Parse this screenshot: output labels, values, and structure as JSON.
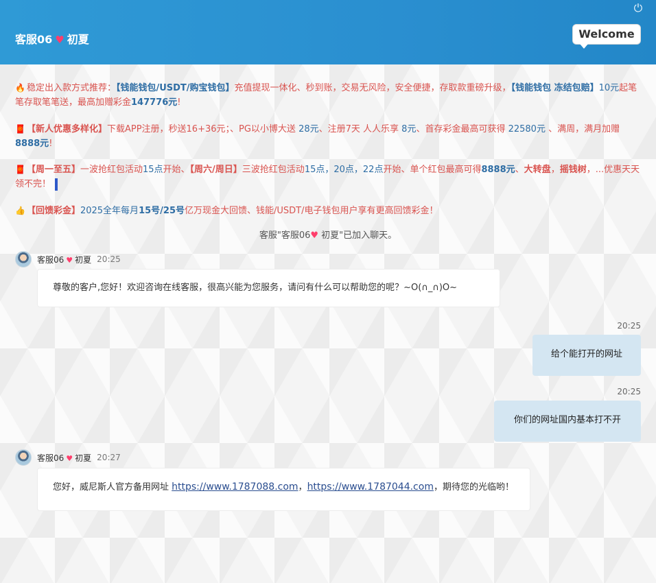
{
  "header": {
    "title_prefix": "客服06",
    "title_heart": "♥",
    "title_suffix": "初夏",
    "welcome": "Welcome",
    "power_icon": "⏻"
  },
  "notices": [
    {
      "icon": "🔥",
      "parts": [
        {
          "t": "稳定出入款方式推荐：",
          "c": "red"
        },
        {
          "t": "【钱能钱包/USDT/购宝钱包】",
          "c": "blue",
          "b": true
        },
        {
          "t": "充值提现一体化、秒到账，交易无风险，安全便捷，存取款重磅升级，",
          "c": "red"
        },
        {
          "t": "【钱能钱包 冻结包赔】",
          "c": "blue",
          "b": true
        },
        {
          "t": "10元",
          "c": "blue"
        },
        {
          "t": "起笔笔存取笔笔送，最高加赠彩金",
          "c": "red"
        },
        {
          "t": "147776元",
          "c": "blue",
          "b": true
        },
        {
          "t": "!",
          "c": "red"
        }
      ]
    },
    {
      "icon": "🧧",
      "parts": [
        {
          "t": "【新人优惠多样化】",
          "c": "red",
          "b": true
        },
        {
          "t": "下载APP注册，秒送16+36元；、PG以小博大送 ",
          "c": "red"
        },
        {
          "t": "28元",
          "c": "blue"
        },
        {
          "t": "、注册7天 人人乐享 ",
          "c": "red"
        },
        {
          "t": "8元",
          "c": "blue"
        },
        {
          "t": "、首存彩金最高可获得 ",
          "c": "red"
        },
        {
          "t": "22580元",
          "c": "blue"
        },
        {
          "t": " 、满周，满月加赠 ",
          "c": "red"
        },
        {
          "t": "8888元",
          "c": "blue",
          "b": true
        },
        {
          "t": "!",
          "c": "red"
        }
      ]
    },
    {
      "icon": "🧧",
      "parts": [
        {
          "t": "【周一至五】",
          "c": "red",
          "b": true
        },
        {
          "t": "一波抢红包活动",
          "c": "red"
        },
        {
          "t": "15点",
          "c": "blue"
        },
        {
          "t": "开始、",
          "c": "red"
        },
        {
          "t": "【周六/周日】",
          "c": "red",
          "b": true
        },
        {
          "t": "三波抢红包活动",
          "c": "red"
        },
        {
          "t": "15点，20点，22点",
          "c": "blue"
        },
        {
          "t": "开始、单个红包最高可得",
          "c": "red"
        },
        {
          "t": "8888元",
          "c": "blue",
          "b": true
        },
        {
          "t": "、",
          "c": "red"
        },
        {
          "t": "大转盘",
          "c": "red",
          "b": true
        },
        {
          "t": "，",
          "c": "red"
        },
        {
          "t": "摇钱树",
          "c": "red",
          "b": true
        },
        {
          "t": "，...优惠天天领不完！",
          "c": "red"
        }
      ]
    },
    {
      "icon": "👍",
      "parts": [
        {
          "t": "【回馈彩金】",
          "c": "red",
          "b": true
        },
        {
          "t": "2025全年每月",
          "c": "blue"
        },
        {
          "t": "15号/25号",
          "c": "blue",
          "b": true
        },
        {
          "t": "亿万现金大回馈、钱能/USDT/电子钱包用户享有更高回馈彩金！",
          "c": "red"
        }
      ]
    }
  ],
  "joined": {
    "prefix": "客服\"客服06",
    "heart": "♥",
    "suffix": " 初夏\"已加入聊天。"
  },
  "messages": [
    {
      "side": "left",
      "name_prefix": "客服06",
      "name_heart": "♥",
      "name_suffix": "初夏",
      "time": "20:25",
      "text": "尊敬的客户,您好！欢迎咨询在线客服，很高兴能为您服务，请问有什么可以帮助您的呢？~O(∩_∩)O~"
    },
    {
      "side": "right",
      "time": "20:25",
      "text": "给个能打开的网址"
    },
    {
      "side": "right",
      "time": "20:25",
      "text": "你们的网址国内基本打不开"
    },
    {
      "side": "left",
      "name_prefix": "客服06",
      "name_heart": "♥",
      "name_suffix": "初夏",
      "time": "20:27",
      "text_before": "您好，威尼斯人官方备用网址 ",
      "link1": "https://www.1787088.com",
      "text_mid": "，",
      "link2": "https://www.1787044.com",
      "text_after": "，期待您的光临哟！"
    }
  ],
  "colors": {
    "header": "#2a8fd0",
    "red_text": "#d9534f",
    "blue_text": "#2e6da4",
    "right_bubble": "#d4e6f2"
  }
}
